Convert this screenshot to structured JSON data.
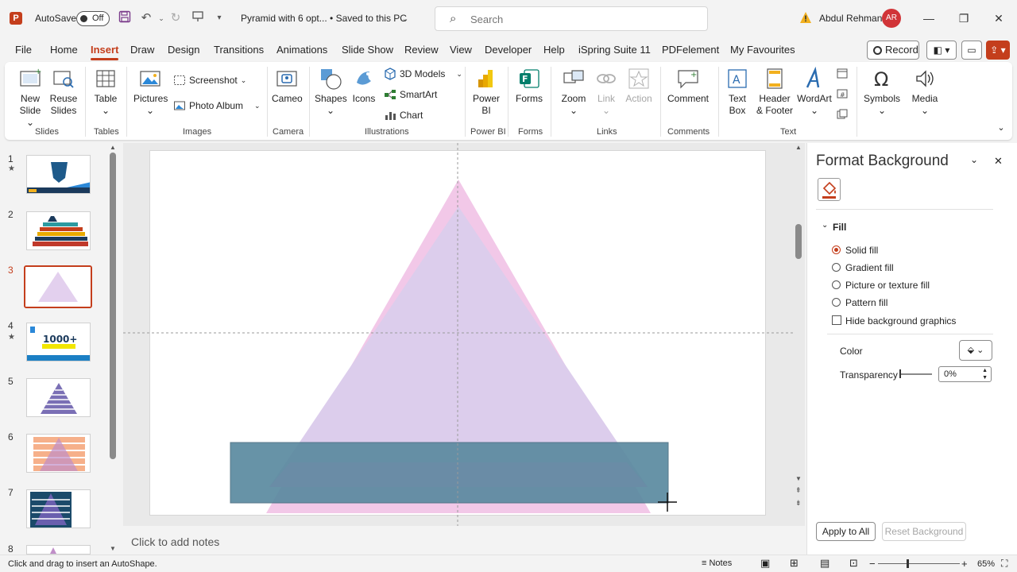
{
  "titlebar": {
    "autosave_label": "AutoSave",
    "autosave_state": "Off",
    "doc_title": "Pyramid with 6 opt... • Saved to this PC",
    "search_placeholder": "Search",
    "user_name": "Abdul Rehman",
    "user_initials": "AR"
  },
  "tabs": [
    "File",
    "Home",
    "Insert",
    "Draw",
    "Design",
    "Transitions",
    "Animations",
    "Slide Show",
    "Review",
    "View",
    "Developer",
    "Help",
    "iSpring Suite 11",
    "PDFelement",
    "My Favourites"
  ],
  "active_tab": "Insert",
  "record_label": "Record",
  "ribbon": {
    "new_slide": "New Slide",
    "reuse_slides": "Reuse Slides",
    "table": "Table",
    "pictures": "Pictures",
    "screenshot": "Screenshot",
    "photo_album": "Photo Album",
    "cameo": "Cameo",
    "shapes": "Shapes",
    "icons": "Icons",
    "models_3d": "3D Models",
    "smartart": "SmartArt",
    "chart": "Chart",
    "power_bi": "Power BI",
    "forms": "Forms",
    "zoom": "Zoom",
    "link": "Link",
    "action": "Action",
    "comment": "Comment",
    "text_box": "Text Box",
    "header_footer": "Header & Footer",
    "wordart": "WordArt",
    "symbols": "Symbols",
    "media": "Media",
    "groups": {
      "slides": "Slides",
      "tables": "Tables",
      "images": "Images",
      "camera": "Camera",
      "illustrations": "Illustrations",
      "power_bi": "Power BI",
      "forms": "Forms",
      "links": "Links",
      "comments": "Comments",
      "text": "Text"
    }
  },
  "thumbnails": [
    "1",
    "2",
    "3",
    "4",
    "5",
    "6",
    "7",
    "8"
  ],
  "thumb4_text": "1000+",
  "notes_placeholder": "Click to add notes",
  "pane": {
    "title": "Format Background",
    "section": "Fill",
    "options": [
      "Solid fill",
      "Gradient fill",
      "Picture or texture fill",
      "Pattern fill"
    ],
    "hide_bg": "Hide background graphics",
    "color_label": "Color",
    "transparency_label": "Transparency",
    "transparency_value": "0%",
    "apply_all": "Apply to All",
    "reset_bg": "Reset Background"
  },
  "status": {
    "hint": "Click and drag to insert an AutoShape.",
    "notes": "Notes",
    "zoom": "65%"
  },
  "colors": {
    "accent": "#c43e1c",
    "pyramid_outer": "#f2c8e8",
    "pyramid_inner": "#dccdec",
    "rect_fill": "#5b8aa0"
  }
}
